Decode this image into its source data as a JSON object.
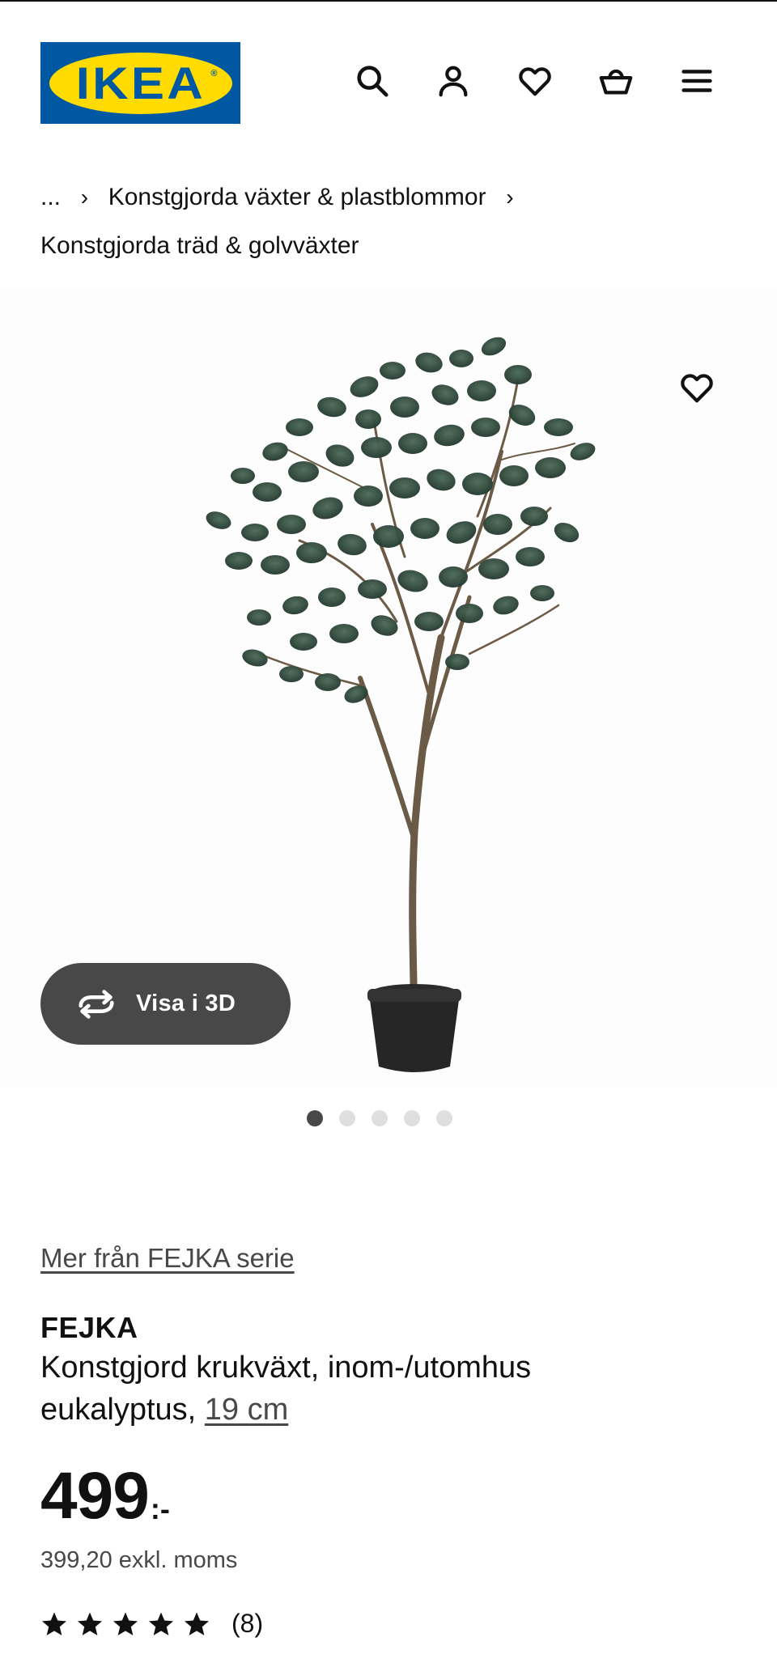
{
  "header": {
    "logo_text": "IKEA",
    "logo_reg": "®",
    "icons": [
      "search-icon",
      "account-icon",
      "heart-icon",
      "basket-icon",
      "menu-icon"
    ]
  },
  "breadcrumb": {
    "ellipsis": "...",
    "items": [
      "Konstgjorda växter & plastblommor",
      "Konstgjorda träd & golvväxter"
    ],
    "separator": "›"
  },
  "gallery": {
    "view3d_label": "Visa i 3D",
    "dot_count": 5,
    "active_dot": 1
  },
  "product": {
    "series_link": "Mer från FEJKA serie",
    "name": "FEJKA",
    "description_line1": "Konstgjord krukväxt, inom-/utomhus",
    "description_line2": "eukalyptus, ",
    "size": "19 cm",
    "price_integer": "499",
    "price_suffix": ":-",
    "price_ex_vat": "399,20 exkl. moms",
    "rating_stars": 5,
    "rating_count": "(8)"
  },
  "colors": {
    "ikea_blue": "#0058a3",
    "ikea_yellow": "#ffdb00",
    "pill_gray": "#484848"
  }
}
